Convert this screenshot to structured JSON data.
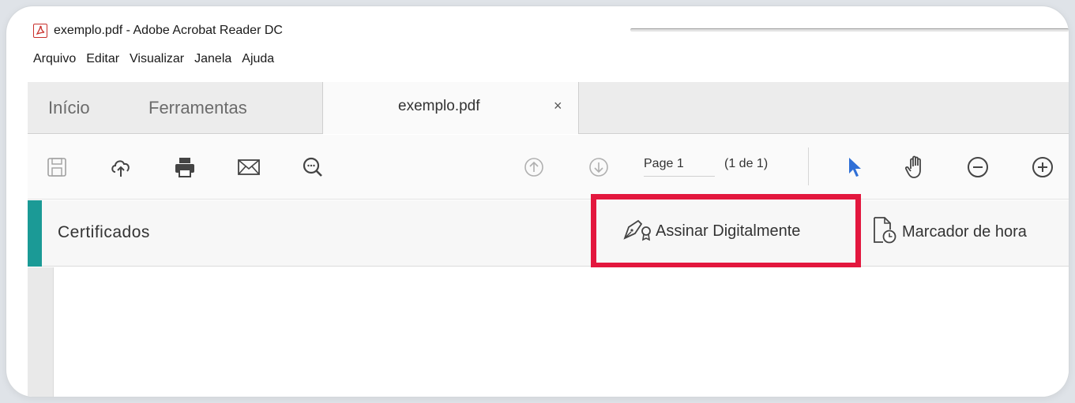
{
  "window": {
    "title": "exemplo.pdf - Adobe Acrobat Reader DC"
  },
  "menu": [
    "Arquivo",
    "Editar",
    "Visualizar",
    "Janela",
    "Ajuda"
  ],
  "tabs": {
    "home": "Início",
    "tools": "Ferramentas",
    "document": "exemplo.pdf",
    "close": "×"
  },
  "toolbar": {
    "icons": [
      "save-icon",
      "cloud-upload-icon",
      "print-icon",
      "email-icon",
      "search-comment-icon",
      "page-up-icon",
      "page-down-icon",
      "select-cursor-icon",
      "hand-tool-icon",
      "zoom-out-icon",
      "zoom-in-icon"
    ],
    "page_label": "Page 1",
    "page_count": "(1 de 1)"
  },
  "panel": {
    "title": "Certificados",
    "sign_label": "Assinar Digitalmente",
    "timestamp_label": "Marcador de hora"
  },
  "colors": {
    "accent_teal": "#1b9a96",
    "highlight_red": "#e3173e",
    "cursor_blue": "#2f6fd6"
  }
}
